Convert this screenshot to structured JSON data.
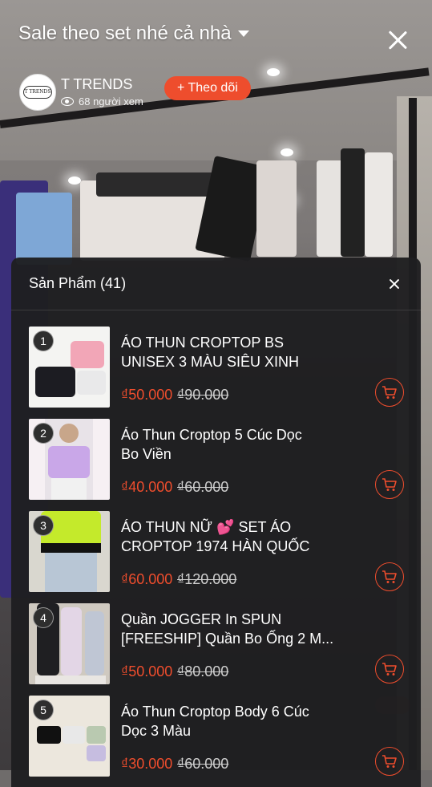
{
  "header": {
    "title": "Sale theo set nhé cả nhà",
    "shop_name": "T TRENDS",
    "shop_logo_text": "T TRENDS",
    "viewers": "68 người xem",
    "follow_label": "+ Theo dõi"
  },
  "panel": {
    "title": "Sản Phẩm (41)",
    "products": [
      {
        "index": "1",
        "name_line1": "ÁO THUN CROPTOP BS",
        "name_line2": "UNISEX 3 MÀU SIÊU XINH",
        "price": "₫50.000",
        "old_price": "₫90.000"
      },
      {
        "index": "2",
        "name_line1": "Áo Thun Croptop 5 Cúc Dọc",
        "name_line2": "Bo Viền",
        "price": "₫40.000",
        "old_price": "₫60.000"
      },
      {
        "index": "3",
        "name_line1": "ÁO THUN NỮ 💕 SET ÁO",
        "name_line2": "CROPTOP 1974 HÀN QUỐC",
        "price": "₫60.000",
        "old_price": "₫120.000"
      },
      {
        "index": "4",
        "name_line1": "Quần JOGGER In SPUN",
        "name_line2": "[FREESHIP] Quần Bo Ống 2 M...",
        "price": "₫50.000",
        "old_price": "₫80.000"
      },
      {
        "index": "5",
        "name_line1": "Áo Thun Croptop Body 6 Cúc",
        "name_line2": "Dọc 3 Màu",
        "price": "₫30.000",
        "old_price": "₫60.000"
      }
    ]
  },
  "icons": {
    "cart": "shopping-cart-icon",
    "close": "close-icon",
    "eye": "eye-icon",
    "caret": "caret-down-icon"
  },
  "colors": {
    "accent": "#ee4d2d",
    "panel": "#1e1e20"
  }
}
